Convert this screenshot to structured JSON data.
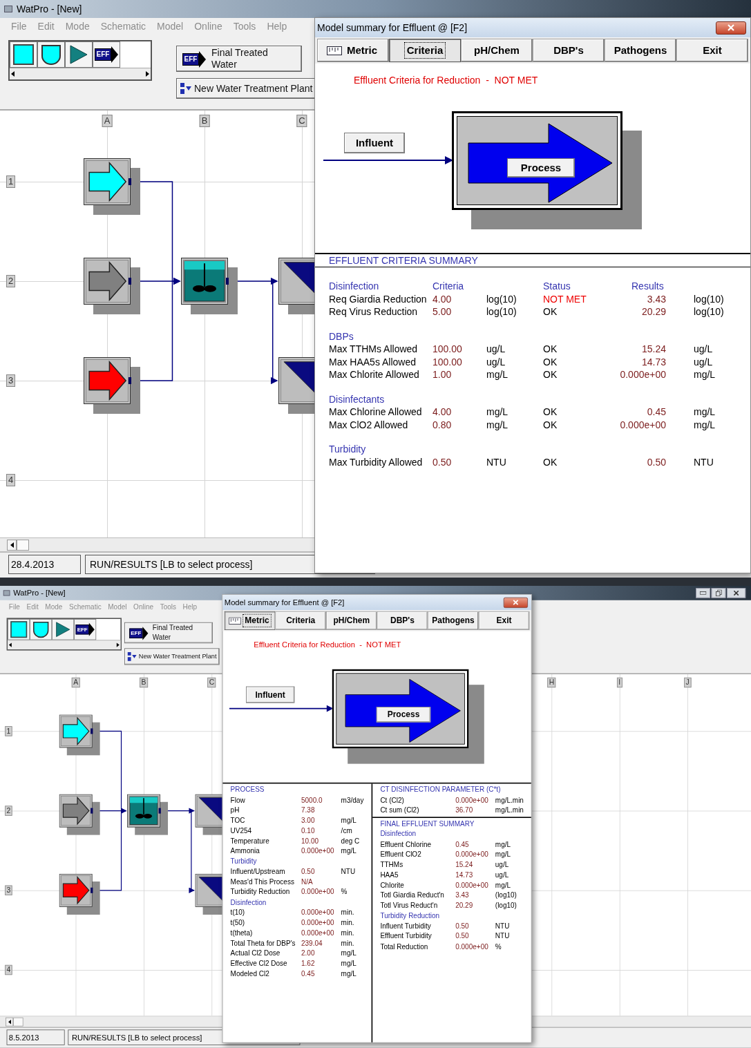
{
  "screens": [
    {
      "window": {
        "title": "WatPro - [New]"
      },
      "menu": [
        "File",
        "Edit",
        "Mode",
        "Schematic",
        "Model",
        "Online",
        "Tools",
        "Help"
      ],
      "palette": [
        {
          "kind": "source"
        },
        {
          "kind": "basin"
        },
        {
          "kind": "pump"
        },
        {
          "kind": "effluent",
          "label": "EFF"
        }
      ],
      "effluent_button": {
        "icon_label": "EFF",
        "label": "Final Treated Water"
      },
      "plant_button": {
        "label": "New Water Treatment Plant"
      },
      "schematic": {
        "columns": [
          "A",
          "B",
          "C"
        ],
        "rows": [
          "1",
          "2",
          "3",
          "4"
        ],
        "nodes": [
          {
            "kind": "influent",
            "color": "#00ffff"
          },
          {
            "kind": "influent",
            "color": "#808080"
          },
          {
            "kind": "influent",
            "color": "#ff0000"
          },
          {
            "kind": "tank"
          },
          {
            "kind": "filter"
          },
          {
            "kind": "filter"
          }
        ]
      },
      "status_bar": {
        "date": "28.4.2013",
        "message": "RUN/RESULTS [LB to select process]"
      },
      "dialog": {
        "title": "Model summary for Effluent @ [F2]",
        "tabs": [
          {
            "kind": "toggle",
            "label": "Metric",
            "selected": false
          },
          {
            "kind": "page",
            "label": "Criteria",
            "selected": true
          },
          {
            "kind": "page",
            "label": "pH/Chem",
            "selected": false
          },
          {
            "kind": "page",
            "label": "DBP's",
            "selected": false
          },
          {
            "kind": "page",
            "label": "Pathogens",
            "selected": false
          },
          {
            "kind": "page",
            "label": "Exit",
            "selected": false
          }
        ],
        "banner": "Effluent Criteria for Reduction  -  NOT MET",
        "diagram": {
          "influent": "Influent",
          "process": "Process"
        },
        "summary": {
          "kind": "criteria",
          "title": "EFFLUENT CRITERIA SUMMARY",
          "columns": [
            "Criteria",
            "Status",
            "Results"
          ],
          "groups": [
            {
              "name": "Disinfection",
              "rows": [
                {
                  "label": "Req Giardia Reduction",
                  "criteria": "4.00",
                  "criteria_unit": "log(10)",
                  "status": "NOT MET",
                  "met": false,
                  "result": "3.43",
                  "result_unit": "log(10)"
                },
                {
                  "label": "Req Virus Reduction",
                  "criteria": "5.00",
                  "criteria_unit": "log(10)",
                  "status": "OK",
                  "met": true,
                  "result": "20.29",
                  "result_unit": "log(10)"
                }
              ]
            },
            {
              "name": "DBPs",
              "rows": [
                {
                  "label": "Max TTHMs Allowed",
                  "criteria": "100.00",
                  "criteria_unit": "ug/L",
                  "status": "OK",
                  "met": true,
                  "result": "15.24",
                  "result_unit": "ug/L"
                },
                {
                  "label": "Max HAA5s Allowed",
                  "criteria": "100.00",
                  "criteria_unit": "ug/L",
                  "status": "OK",
                  "met": true,
                  "result": "14.73",
                  "result_unit": "ug/L"
                },
                {
                  "label": "Max Chlorite Allowed",
                  "criteria": "1.00",
                  "criteria_unit": "mg/L",
                  "status": "OK",
                  "met": true,
                  "result": "0.000e+00",
                  "result_unit": "mg/L"
                }
              ]
            },
            {
              "name": "Disinfectants",
              "rows": [
                {
                  "label": "Max Chlorine Allowed",
                  "criteria": "4.00",
                  "criteria_unit": "mg/L",
                  "status": "OK",
                  "met": true,
                  "result": "0.45",
                  "result_unit": "mg/L"
                },
                {
                  "label": "Max ClO2 Allowed",
                  "criteria": "0.80",
                  "criteria_unit": "mg/L",
                  "status": "OK",
                  "met": true,
                  "result": "0.000e+00",
                  "result_unit": "mg/L"
                }
              ]
            },
            {
              "name": "Turbidity",
              "rows": [
                {
                  "label": "Max Turbidity Allowed",
                  "criteria": "0.50",
                  "criteria_unit": "NTU",
                  "status": "OK",
                  "met": true,
                  "result": "0.50",
                  "result_unit": "NTU"
                }
              ]
            }
          ]
        }
      }
    },
    {
      "window": {
        "title": "WatPro - [New]"
      },
      "menu": [
        "File",
        "Edit",
        "Mode",
        "Schematic",
        "Model",
        "Online",
        "Tools",
        "Help"
      ],
      "palette": [
        {
          "kind": "source"
        },
        {
          "kind": "basin"
        },
        {
          "kind": "pump"
        },
        {
          "kind": "effluent",
          "label": "EFF"
        }
      ],
      "effluent_button": {
        "icon_label": "EFF",
        "label": "Final Treated Water"
      },
      "plant_button": {
        "label": "New Water Treatment Plant"
      },
      "schematic": {
        "columns": [
          "A",
          "B",
          "C",
          "H",
          "I",
          "J"
        ],
        "rows": [
          "1",
          "2",
          "3",
          "4"
        ],
        "nodes": [
          {
            "kind": "influent",
            "color": "#00ffff"
          },
          {
            "kind": "influent",
            "color": "#808080"
          },
          {
            "kind": "influent",
            "color": "#ff0000"
          },
          {
            "kind": "tank"
          },
          {
            "kind": "filter"
          },
          {
            "kind": "filter"
          }
        ]
      },
      "status_bar": {
        "date": "8.5.2013",
        "message": "RUN/RESULTS [LB to select process]"
      },
      "dialog": {
        "title": "Model summary for Effluent @ [F2]",
        "tabs": [
          {
            "kind": "toggle",
            "label": "Metric",
            "selected": true
          },
          {
            "kind": "page",
            "label": "Criteria",
            "selected": false
          },
          {
            "kind": "page",
            "label": "pH/Chem",
            "selected": false
          },
          {
            "kind": "page",
            "label": "DBP's",
            "selected": false
          },
          {
            "kind": "page",
            "label": "Pathogens",
            "selected": false
          },
          {
            "kind": "page",
            "label": "Exit",
            "selected": false
          }
        ],
        "banner": "Effluent Criteria for Reduction  -  NOT MET",
        "diagram": {
          "influent": "Influent",
          "process": "Process"
        },
        "summary": {
          "kind": "process",
          "columns": [
            {
              "panels": [
                {
                  "items": [
                    {
                      "kind": "heading",
                      "label": "PROCESS"
                    },
                    {
                      "kind": "row",
                      "label": "Flow",
                      "value": "5000.0",
                      "unit": "m3/day"
                    },
                    {
                      "kind": "row",
                      "label": "pH",
                      "value": "7.38"
                    },
                    {
                      "kind": "row",
                      "label": "TOC",
                      "value": "3.00",
                      "unit": "mg/L"
                    },
                    {
                      "kind": "row",
                      "label": "UV254",
                      "value": "0.10",
                      "unit": "/cm"
                    },
                    {
                      "kind": "row",
                      "label": "Temperature",
                      "value": "10.00",
                      "unit": "deg C"
                    },
                    {
                      "kind": "row",
                      "label": "Ammonia",
                      "value": "0.000e+00",
                      "unit": "mg/L"
                    },
                    {
                      "kind": "heading",
                      "label": "Turbidity"
                    },
                    {
                      "kind": "row",
                      "label": "Influent/Upstream",
                      "value": "0.50",
                      "unit": "NTU"
                    },
                    {
                      "kind": "row",
                      "label": "Meas'd This Process",
                      "value": "N/A"
                    },
                    {
                      "kind": "row",
                      "label": "Turbidity Reduction",
                      "value": "0.000e+00",
                      "unit": "%"
                    },
                    {
                      "kind": "heading",
                      "label": "Disinfection"
                    },
                    {
                      "kind": "row",
                      "label": "t(10)",
                      "value": "0.000e+00",
                      "unit": "min."
                    },
                    {
                      "kind": "row",
                      "label": "t(50)",
                      "value": "0.000e+00",
                      "unit": "min."
                    },
                    {
                      "kind": "row",
                      "label": "t(theta)",
                      "value": "0.000e+00",
                      "unit": "min."
                    },
                    {
                      "kind": "row",
                      "label": "Total Theta for DBP's",
                      "value": "239.04",
                      "unit": "min."
                    },
                    {
                      "kind": "row",
                      "label": "Actual Cl2 Dose",
                      "value": "2.00",
                      "unit": "mg/L"
                    },
                    {
                      "kind": "row",
                      "label": "Effective Cl2 Dose",
                      "value": "1.62",
                      "unit": "mg/L"
                    },
                    {
                      "kind": "row",
                      "label": "Modeled Cl2",
                      "value": "0.45",
                      "unit": "mg/L"
                    }
                  ]
                }
              ]
            },
            {
              "panels": [
                {
                  "items": [
                    {
                      "kind": "heading",
                      "label": "CT DISINFECTION PARAMETER (C*t)"
                    },
                    {
                      "kind": "row",
                      "label": "Ct (Cl2)",
                      "value": "0.000e+00",
                      "unit": "mg/L.min"
                    },
                    {
                      "kind": "row",
                      "label": "Ct sum (Cl2)",
                      "value": "36.70",
                      "unit": "mg/L.min"
                    }
                  ]
                },
                {
                  "items": [
                    {
                      "kind": "heading",
                      "label": "FINAL EFFLUENT SUMMARY"
                    },
                    {
                      "kind": "heading",
                      "label": "Disinfection"
                    },
                    {
                      "kind": "row",
                      "label": "Effluent Chlorine",
                      "value": "0.45",
                      "unit": "mg/L"
                    },
                    {
                      "kind": "row",
                      "label": "Effluent ClO2",
                      "value": "0.000e+00",
                      "unit": "mg/L"
                    },
                    {
                      "kind": "row",
                      "label": "TTHMs",
                      "value": "15.24",
                      "unit": "ug/L"
                    },
                    {
                      "kind": "row",
                      "label": "HAA5",
                      "value": "14.73",
                      "unit": "ug/L"
                    },
                    {
                      "kind": "row",
                      "label": "Chlorite",
                      "value": "0.000e+00",
                      "unit": "mg/L"
                    },
                    {
                      "kind": "row",
                      "label": "Totl Giardia Reduct'n",
                      "value": "3.43",
                      "unit": "(log10)"
                    },
                    {
                      "kind": "row",
                      "label": "Totl Virus Reduct'n",
                      "value": "20.29",
                      "unit": "(log10)"
                    },
                    {
                      "kind": "heading",
                      "label": "Turbidity Reduction"
                    },
                    {
                      "kind": "row",
                      "label": "Influent Turbidity",
                      "value": "0.50",
                      "unit": "NTU"
                    },
                    {
                      "kind": "row",
                      "label": "Effluent Turbidity",
                      "value": "0.50",
                      "unit": "NTU"
                    },
                    {
                      "kind": "row",
                      "label": "Total Reduction",
                      "value": "0.000e+00",
                      "unit": "%"
                    }
                  ]
                }
              ]
            }
          ]
        }
      }
    }
  ]
}
